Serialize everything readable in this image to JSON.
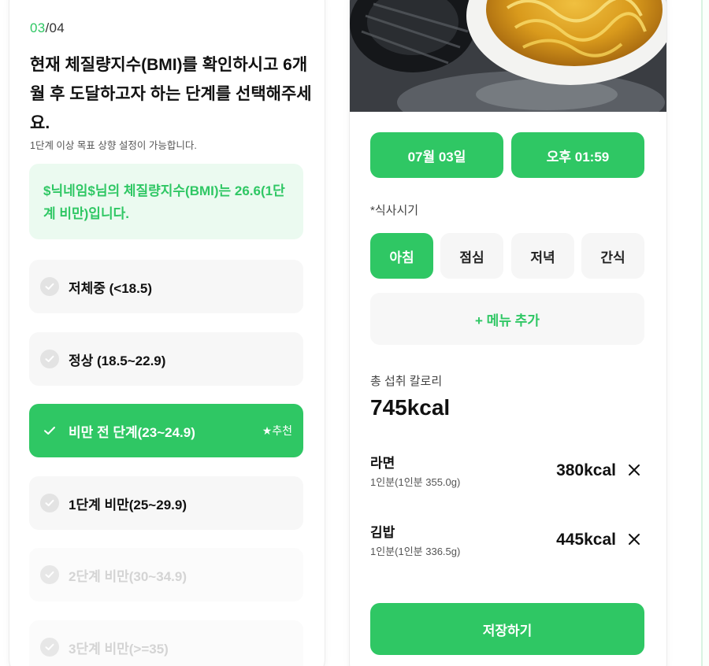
{
  "goal_screen": {
    "step_current": "03",
    "step_total": "/04",
    "title": "현재 체질량지수(BMI)를 확인하시고 6개월 후 도달하고자 하는 단계를 선택해주세요.",
    "subtitle": "1단계 이상 목표 상향 설정이 가능합니다.",
    "bmi_message": "$닉네임$님의 체질량지수(BMI)는 26.6(1단계 비만)입니다.",
    "options": [
      {
        "label": "저체중 (<18.5)"
      },
      {
        "label": "정상 (18.5~22.9)"
      },
      {
        "label": "비만 전 단계(23~24.9)",
        "badge": "★추천"
      },
      {
        "label": "1단계 비만(25~29.9)"
      },
      {
        "label": "2단계 비만(30~34.9)"
      },
      {
        "label": "3단계 비만(>=35)"
      }
    ]
  },
  "meal_screen": {
    "date": "07월 03일",
    "time": "오후 01:59",
    "meal_time_label": "*식사시기",
    "meal_times": [
      "아침",
      "점심",
      "저녁",
      "간식"
    ],
    "add_menu": "+ 메뉴 추가",
    "total_label": "총 섭취 칼로리",
    "total_value": "745kcal",
    "foods": [
      {
        "name": "라면",
        "serving": "1인분(1인분 355.0g)",
        "kcal": "380kcal"
      },
      {
        "name": "김밥",
        "serving": "1인분(1인분 336.5g)",
        "kcal": "445kcal"
      }
    ],
    "save": "저장하기"
  },
  "colors": {
    "accent": "#2fc764",
    "accent_light": "#ebfaf0",
    "option_bg": "#f7f7f7",
    "disabled_text": "#d4d4d4"
  },
  "icons": {
    "check": "check-icon",
    "delete": "close-icon"
  }
}
